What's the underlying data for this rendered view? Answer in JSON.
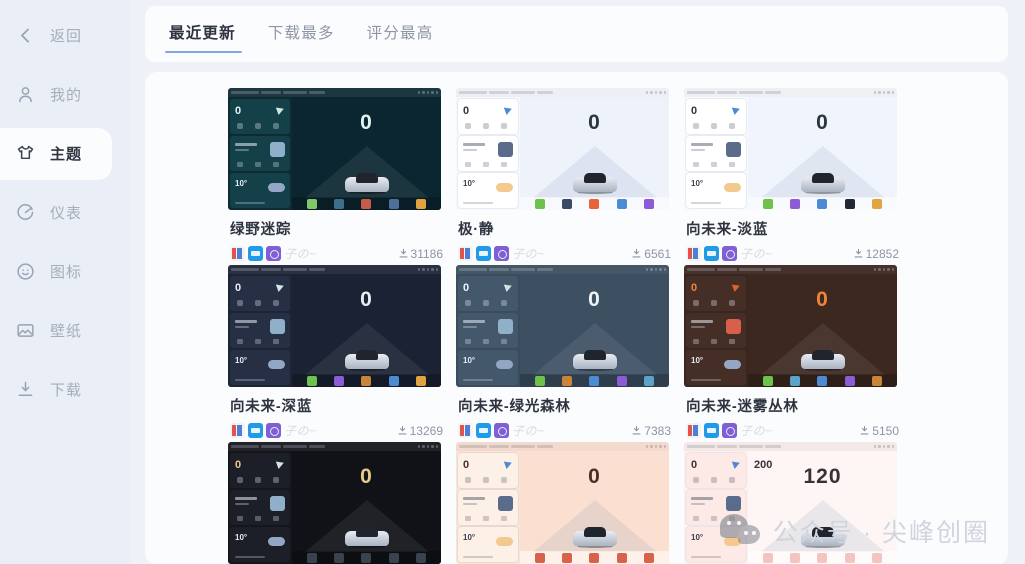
{
  "sidebar": {
    "items": [
      {
        "label": "返回",
        "icon": "chevron-left-icon",
        "active": false
      },
      {
        "label": "我的",
        "icon": "user-icon",
        "active": false
      },
      {
        "label": "主题",
        "icon": "tshirt-icon",
        "active": true
      },
      {
        "label": "仪表",
        "icon": "gauge-icon",
        "active": false
      },
      {
        "label": "图标",
        "icon": "smiley-icon",
        "active": false
      },
      {
        "label": "壁纸",
        "icon": "image-icon",
        "active": false
      },
      {
        "label": "下载",
        "icon": "download-icon",
        "active": false
      }
    ]
  },
  "tabs": [
    {
      "label": "最近更新",
      "active": true
    },
    {
      "label": "下载最多",
      "active": false
    },
    {
      "label": "评分最高",
      "active": false
    }
  ],
  "author_signature": "子の~",
  "download_icon": "download-icon",
  "colors": {
    "accent": "#8aa2e8",
    "page_bg": "#eef1f7",
    "sidebar_bg": "#eaeef6",
    "card_bg": "#fbfcfe",
    "title_text": "#2f3540",
    "muted_text": "#8d95a5"
  },
  "themes": [
    {
      "title": "绿野迷踪",
      "downloads": "31186",
      "speed": "0",
      "style": "dark-teal",
      "bg": "#0e2b33",
      "widget_bg": "#14404a",
      "main_bg": "#0b2630",
      "speed_color": "#dff3f2",
      "dock": [
        "#7ec86a",
        "#3b6f8a",
        "#c85a4a",
        "#4d6f9a",
        "#e0a340"
      ]
    },
    {
      "title": "极·静",
      "downloads": "6561",
      "speed": "0",
      "style": "light",
      "bg": "#f6f8fd",
      "widget_bg": "#ffffff",
      "main_bg": "#eef2fb",
      "speed_color": "#2f3540",
      "dock": [
        "#6cc24a",
        "#3a4a63",
        "#e8623a",
        "#4c8ad4",
        "#8b5cd6"
      ]
    },
    {
      "title": "向未来-淡蓝",
      "downloads": "12852",
      "speed": "0",
      "style": "light",
      "bg": "#f7f9fd",
      "widget_bg": "#ffffff",
      "main_bg": "#f0f4fc",
      "speed_color": "#2f3540",
      "dock": [
        "#6cc24a",
        "#8b5cd6",
        "#4c8ad4",
        "#222831",
        "#e0a340"
      ]
    },
    {
      "title": "向未来-深蓝",
      "downloads": "13269",
      "speed": "0",
      "style": "dark",
      "bg": "#1c2436",
      "widget_bg": "#262f44",
      "main_bg": "#1a2233",
      "speed_color": "#e8ecf4",
      "dock": [
        "#6cc24a",
        "#8b5cd6",
        "#c9843a",
        "#4c8ad4",
        "#e0a340"
      ]
    },
    {
      "title": "向未来-绿光森林",
      "downloads": "7383",
      "speed": "0",
      "style": "dark-blue",
      "bg": "#3a4c5e",
      "widget_bg": "#44586b",
      "main_bg": "#3d5062",
      "speed_color": "#eef3f8",
      "dock": [
        "#6cc24a",
        "#c9843a",
        "#4c8ad4",
        "#8b5cd6",
        "#5ba3c9"
      ]
    },
    {
      "title": "向未来-迷雾丛林",
      "downloads": "5150",
      "speed": "0",
      "style": "dark-brown",
      "bg": "#3a2620",
      "widget_bg": "#452e26",
      "main_bg": "#3d2820",
      "speed_color": "#f0843a",
      "dock": [
        "#6cc24a",
        "#5ba3c9",
        "#4c8ad4",
        "#8b5cd6",
        "#c9843a"
      ]
    },
    {
      "title": "",
      "downloads": "",
      "speed": "0",
      "style": "dark-black",
      "bg": "#14161c",
      "widget_bg": "#1c1f27",
      "main_bg": "#101218",
      "speed_color": "#e8c98a",
      "dock": [
        "#3a4250",
        "#3a4250",
        "#3a4250",
        "#3a4250",
        "#3a4250"
      ]
    },
    {
      "title": "",
      "downloads": "",
      "speed": "0",
      "style": "festive-red",
      "bg": "#fbe3d6",
      "widget_bg": "#fdf0e6",
      "main_bg": "#fbdfd0",
      "speed_color": "#4a3028",
      "dock": [
        "#d8624a",
        "#d8624a",
        "#d8624a",
        "#d8624a",
        "#d8624a"
      ]
    },
    {
      "title": "",
      "downloads": "",
      "speed": "120",
      "secondary_value": "200",
      "style": "festive-pink",
      "bg": "#fdf2f0",
      "widget_bg": "#fdeae6",
      "main_bg": "#fdf6f4",
      "speed_color": "#3a3038",
      "dock": [
        "#f4c4c0",
        "#f4c4c0",
        "#f4c4c0",
        "#f4c4c0",
        "#f4c4c0"
      ]
    }
  ],
  "watermark": {
    "text": "公众号 · 尖峰创圈",
    "logo": "wechat-icon"
  }
}
